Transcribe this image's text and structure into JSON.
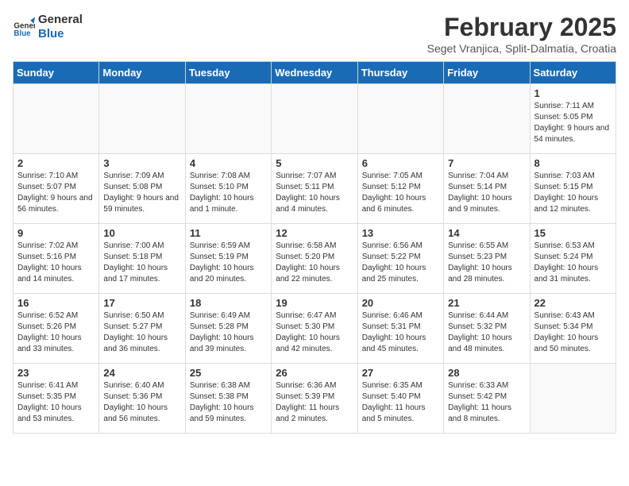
{
  "header": {
    "logo_line1": "General",
    "logo_line2": "Blue",
    "month": "February 2025",
    "location": "Seget Vranjica, Split-Dalmatia, Croatia"
  },
  "weekdays": [
    "Sunday",
    "Monday",
    "Tuesday",
    "Wednesday",
    "Thursday",
    "Friday",
    "Saturday"
  ],
  "weeks": [
    [
      {
        "day": "",
        "info": ""
      },
      {
        "day": "",
        "info": ""
      },
      {
        "day": "",
        "info": ""
      },
      {
        "day": "",
        "info": ""
      },
      {
        "day": "",
        "info": ""
      },
      {
        "day": "",
        "info": ""
      },
      {
        "day": "1",
        "info": "Sunrise: 7:11 AM\nSunset: 5:05 PM\nDaylight: 9 hours and 54 minutes."
      }
    ],
    [
      {
        "day": "2",
        "info": "Sunrise: 7:10 AM\nSunset: 5:07 PM\nDaylight: 9 hours and 56 minutes."
      },
      {
        "day": "3",
        "info": "Sunrise: 7:09 AM\nSunset: 5:08 PM\nDaylight: 9 hours and 59 minutes."
      },
      {
        "day": "4",
        "info": "Sunrise: 7:08 AM\nSunset: 5:10 PM\nDaylight: 10 hours and 1 minute."
      },
      {
        "day": "5",
        "info": "Sunrise: 7:07 AM\nSunset: 5:11 PM\nDaylight: 10 hours and 4 minutes."
      },
      {
        "day": "6",
        "info": "Sunrise: 7:05 AM\nSunset: 5:12 PM\nDaylight: 10 hours and 6 minutes."
      },
      {
        "day": "7",
        "info": "Sunrise: 7:04 AM\nSunset: 5:14 PM\nDaylight: 10 hours and 9 minutes."
      },
      {
        "day": "8",
        "info": "Sunrise: 7:03 AM\nSunset: 5:15 PM\nDaylight: 10 hours and 12 minutes."
      }
    ],
    [
      {
        "day": "9",
        "info": "Sunrise: 7:02 AM\nSunset: 5:16 PM\nDaylight: 10 hours and 14 minutes."
      },
      {
        "day": "10",
        "info": "Sunrise: 7:00 AM\nSunset: 5:18 PM\nDaylight: 10 hours and 17 minutes."
      },
      {
        "day": "11",
        "info": "Sunrise: 6:59 AM\nSunset: 5:19 PM\nDaylight: 10 hours and 20 minutes."
      },
      {
        "day": "12",
        "info": "Sunrise: 6:58 AM\nSunset: 5:20 PM\nDaylight: 10 hours and 22 minutes."
      },
      {
        "day": "13",
        "info": "Sunrise: 6:56 AM\nSunset: 5:22 PM\nDaylight: 10 hours and 25 minutes."
      },
      {
        "day": "14",
        "info": "Sunrise: 6:55 AM\nSunset: 5:23 PM\nDaylight: 10 hours and 28 minutes."
      },
      {
        "day": "15",
        "info": "Sunrise: 6:53 AM\nSunset: 5:24 PM\nDaylight: 10 hours and 31 minutes."
      }
    ],
    [
      {
        "day": "16",
        "info": "Sunrise: 6:52 AM\nSunset: 5:26 PM\nDaylight: 10 hours and 33 minutes."
      },
      {
        "day": "17",
        "info": "Sunrise: 6:50 AM\nSunset: 5:27 PM\nDaylight: 10 hours and 36 minutes."
      },
      {
        "day": "18",
        "info": "Sunrise: 6:49 AM\nSunset: 5:28 PM\nDaylight: 10 hours and 39 minutes."
      },
      {
        "day": "19",
        "info": "Sunrise: 6:47 AM\nSunset: 5:30 PM\nDaylight: 10 hours and 42 minutes."
      },
      {
        "day": "20",
        "info": "Sunrise: 6:46 AM\nSunset: 5:31 PM\nDaylight: 10 hours and 45 minutes."
      },
      {
        "day": "21",
        "info": "Sunrise: 6:44 AM\nSunset: 5:32 PM\nDaylight: 10 hours and 48 minutes."
      },
      {
        "day": "22",
        "info": "Sunrise: 6:43 AM\nSunset: 5:34 PM\nDaylight: 10 hours and 50 minutes."
      }
    ],
    [
      {
        "day": "23",
        "info": "Sunrise: 6:41 AM\nSunset: 5:35 PM\nDaylight: 10 hours and 53 minutes."
      },
      {
        "day": "24",
        "info": "Sunrise: 6:40 AM\nSunset: 5:36 PM\nDaylight: 10 hours and 56 minutes."
      },
      {
        "day": "25",
        "info": "Sunrise: 6:38 AM\nSunset: 5:38 PM\nDaylight: 10 hours and 59 minutes."
      },
      {
        "day": "26",
        "info": "Sunrise: 6:36 AM\nSunset: 5:39 PM\nDaylight: 11 hours and 2 minutes."
      },
      {
        "day": "27",
        "info": "Sunrise: 6:35 AM\nSunset: 5:40 PM\nDaylight: 11 hours and 5 minutes."
      },
      {
        "day": "28",
        "info": "Sunrise: 6:33 AM\nSunset: 5:42 PM\nDaylight: 11 hours and 8 minutes."
      },
      {
        "day": "",
        "info": ""
      }
    ]
  ]
}
